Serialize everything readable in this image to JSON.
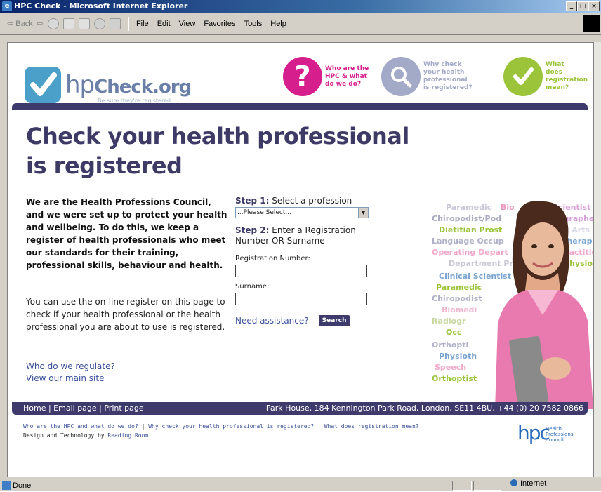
{
  "window": {
    "title": "HPC Check - Microsoft Internet Explorer",
    "minimize": "_",
    "maximize": "□",
    "close": "×"
  },
  "toolbar": {
    "back": "⇦ Back",
    "forward": "⇨",
    "menu": [
      "File",
      "Edit",
      "View",
      "Favorites",
      "Tools",
      "Help"
    ]
  },
  "site": {
    "logo_text": "Check.org",
    "logo_prefix": "hp",
    "logo_tagline": "Be sure they're registered",
    "topnav": [
      {
        "label": "Who are the HPC & what do we do?",
        "color": "#d61f8c"
      },
      {
        "label": "Why check your health professional is registered?",
        "color": "#a2aac8"
      },
      {
        "label": "What does registration mean?",
        "color": "#9cc43a"
      }
    ],
    "headline_line1": "Check your health professional",
    "headline_line2": "is registered",
    "intro": "We are the Health Professions Council, and we were set up to protect your health and wellbeing. To do this, we keep a register of health professionals who meet our standards for their training, professional skills, behaviour and health.",
    "intro2": "You can use the on-line register on this page to check if your health professional or the health professional you are about to use is registered.",
    "link_regulate": "Who do we regulate?",
    "link_main": "View our main site"
  },
  "form": {
    "step1_prefix": "Step 1:",
    "step1_text": " Select a profession",
    "select_value": "...Please Select...",
    "step2_prefix": "Step 2:",
    "step2_text": " Enter a Registration Number OR Surname",
    "reg_label": "Registration Number:",
    "surname_label": "Surname:",
    "assist_link": "Need assistance?",
    "search_label": "Search"
  },
  "wordcloud": [
    "Paramedic",
    "Bio",
    "Scientist",
    "Chiropodist/Pod",
    "ographer",
    "Dietitian Prost",
    "ist Arts",
    "Language Occup",
    "Therapi",
    "Operating Depart",
    "Practitio",
    "Department Prac",
    "Physiot",
    "Clinical Scientist",
    "Paramedic",
    "Chiropodist",
    "Biomedi",
    "Radiogr",
    "Occ",
    "Orthopti",
    "Physioth",
    "Speech",
    "Orthoptist"
  ],
  "footer": {
    "left": "Home | Email page | Print page",
    "address": "Park House, 184 Kennington Park Road, London, SE11 4BU, +44 (0) 20 7582 0866",
    "link1": "Who are the HPC and what do we do?",
    "link2": "Why check your health professional is registered?",
    "link3": "What does registration mean?",
    "credit_prefix": "Design and Technology by ",
    "credit_link": "Reading Room",
    "hpc_logo": "hpc",
    "hpc_sub": "Health Professions Council"
  },
  "status": {
    "text": "Done",
    "zone": "Internet"
  }
}
